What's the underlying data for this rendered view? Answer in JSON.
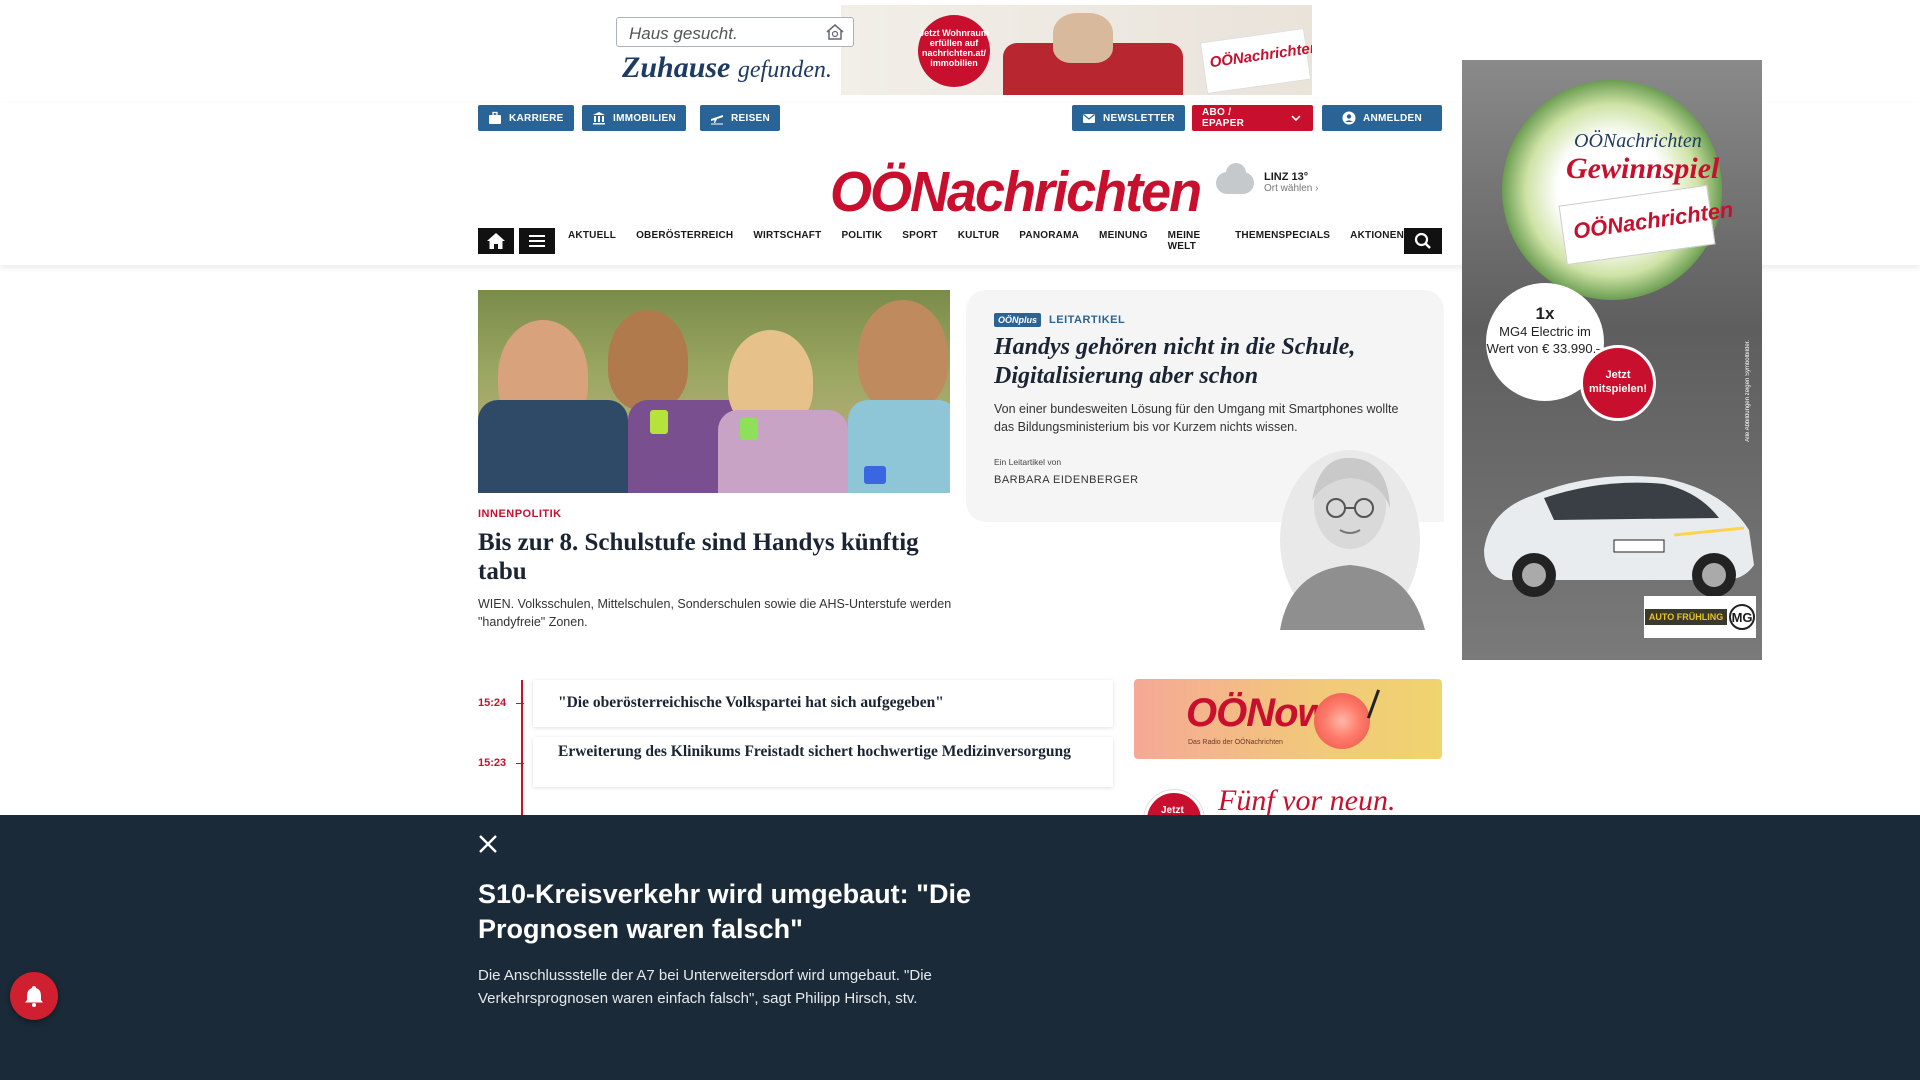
{
  "top_ad": {
    "search_text": "Haus gesucht.",
    "slogan_main": "Zuhause",
    "slogan_sub": "gefunden.",
    "badge": "Jetzt Wohnraum erfüllen auf nachrichten.at/ immobilien",
    "paper": "OÖNachrichten"
  },
  "header": {
    "left_buttons": [
      {
        "label": "KARRIERE",
        "icon": "briefcase-icon"
      },
      {
        "label": "IMMOBILIEN",
        "icon": "building-icon"
      },
      {
        "label": "REISEN",
        "icon": "plane-icon"
      }
    ],
    "newsletter_label": "NEWSLETTER",
    "abo_label": "ABO / EPAPER",
    "login_label": "ANMELDEN",
    "logo": "OÖNachrichten",
    "weather": {
      "city": "LINZ 13°",
      "choose": "Ort wählen"
    },
    "nav_items": [
      "AKTUELL",
      "OBERÖSTERREICH",
      "WIRTSCHAFT",
      "POLITIK",
      "SPORT",
      "KULTUR",
      "PANORAMA",
      "MEINUNG",
      "MEINE WELT",
      "THEMENSPECIALS",
      "AKTIONEN"
    ]
  },
  "lead": {
    "kicker": "INNENPOLITIK",
    "title": "Bis zur 8. Schulstufe sind Handys künftig tabu",
    "teaser": "WIEN. Volksschulen, Mittelschulen, Sonderschulen sowie die AHS-Unterstufe werden \"handyfreie\" Zonen."
  },
  "editorial": {
    "plus_badge": "OÖNplus",
    "kicker": "LEITARTIKEL",
    "title": "Handys gehören nicht in die Schule, Digitalisierung aber schon",
    "teaser": "Von einer bundesweiten Lösung für den Umgang mit Smartphones wollte das Bildungsministerium bis vor Kurzem nichts wissen.",
    "by_label": "Ein Leitartikel von",
    "author": "BARBARA EIDENBERGER"
  },
  "ticker": [
    {
      "time": "15:24",
      "title": "\"Die oberösterreichische Volkspartei hat sich aufgegeben\""
    },
    {
      "time": "15:23",
      "title": "Erweiterung des Klinikums Freistadt sichert hochwertige Medizinversorgung"
    }
  ],
  "now_banner": {
    "logo": "OÖNow",
    "sub": "Das Radio der OÖNachrichten"
  },
  "five_banner": {
    "badge": "Jetzt",
    "text": "Fünf vor neun."
  },
  "side_ad": {
    "line1": "OÖNachrichten",
    "line2": "Gewinnspiel",
    "paper": "OÖNachrichten",
    "prize_count": "1x",
    "prize_text": "MG4 Electric im Wert von € 33.990,–",
    "cta": "Jetzt mitspielen!",
    "brand1": "AUTO FRÜHLING",
    "brand2": "MG",
    "disclaimer": "Alle Abbildungen zeigen Symbolbilder."
  },
  "overlay": {
    "title": "S10-Kreisverkehr wird umgebaut: \"Die Prognosen waren falsch\"",
    "teaser": "Die Anschlussstelle der A7 bei Unterweitersdorf wird umgebaut. \"Die Verkehrsprognosen waren einfach falsch\", sagt Philipp Hirsch, stv."
  },
  "colors": {
    "brand_red": "#c8102e",
    "brand_blue": "#2a6496",
    "overlay_bg": "#1b2a38"
  }
}
